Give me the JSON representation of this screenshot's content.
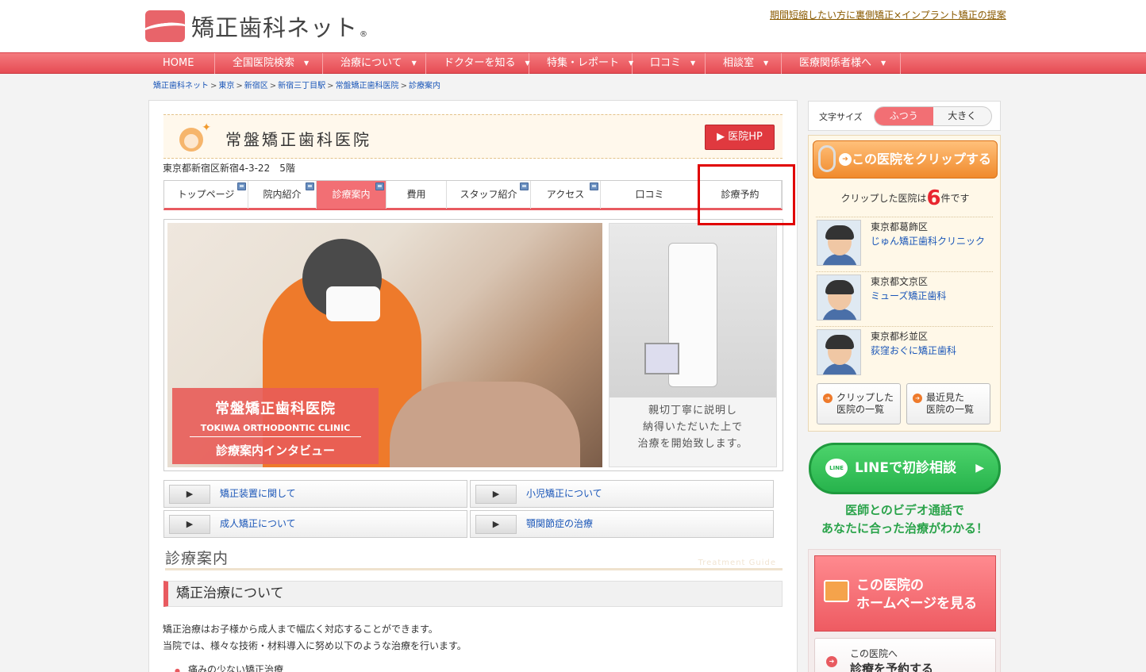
{
  "header": {
    "logo_text": "矯正歯科ネット",
    "logo_mark": "®",
    "top_link": "期間短縮したい方に裏側矯正×インプラント矯正の提案"
  },
  "nav": {
    "items": [
      {
        "label": "HOME",
        "caret": false
      },
      {
        "label": "全国医院検索",
        "caret": true
      },
      {
        "label": "治療について",
        "caret": true
      },
      {
        "label": "ドクターを知る",
        "caret": true
      },
      {
        "label": "特集・レポート",
        "caret": true
      },
      {
        "label": "口コミ",
        "caret": true
      },
      {
        "label": "相談室",
        "caret": true
      },
      {
        "label": "医療関係者様へ",
        "caret": true
      }
    ]
  },
  "breadcrumb": {
    "items": [
      "矯正歯科ネット",
      "東京",
      "新宿区",
      "新宿三丁目駅",
      "常盤矯正歯科医院",
      "診療案内"
    ],
    "sep": ">"
  },
  "clinic": {
    "name": "常盤矯正歯科医院",
    "hp_button": "▶ 医院HP",
    "address": "東京都新宿区新宿4-3-22　5階"
  },
  "tabs": [
    {
      "label": "トップページ",
      "new": true,
      "active": false
    },
    {
      "label": "院内紹介",
      "new": true,
      "active": false
    },
    {
      "label": "診療案内",
      "new": true,
      "active": true
    },
    {
      "label": "費用",
      "new": false,
      "active": false
    },
    {
      "label": "スタッフ紹介",
      "new": true,
      "active": false
    },
    {
      "label": "アクセス",
      "new": true,
      "active": false
    },
    {
      "label": "口コミ",
      "new": false,
      "active": false
    },
    {
      "label": "診療予約",
      "new": false,
      "active": false
    }
  ],
  "hero": {
    "label_title": "常盤矯正歯科医院",
    "label_en": "TOKIWA ORTHODONTIC CLINIC",
    "label_sub": "診療案内インタビュー",
    "caption_lines": [
      "親切丁寧に説明し",
      "納得いただいた上で",
      "治療を開始致します。"
    ]
  },
  "links": [
    {
      "label": "矯正装置に関して",
      "arrow": "▶"
    },
    {
      "label": "小児矯正について",
      "arrow": "▶"
    },
    {
      "label": "成人矯正について",
      "arrow": "▶"
    },
    {
      "label": "顎関節症の治療",
      "arrow": "▶"
    }
  ],
  "section": {
    "title": "診療案内",
    "title_en": "Treatment Guide",
    "subtitle": "矯正治療について",
    "paragraph_lines": [
      "矯正治療はお子様から成人まで幅広く対応することができます。",
      "当院では、様々な技術・材料導入に努め以下のような治療を行います。"
    ],
    "bullet": "痛みの少ない矯正治療"
  },
  "sidebar": {
    "font_size_label": "文字サイズ",
    "size_normal": "ふつう",
    "size_large": "大きく",
    "clip_button": "この医院をクリップする",
    "clip_count_prefix": "クリップした医院は",
    "clip_count": "6",
    "clip_count_suffix": "件です",
    "clinics": [
      {
        "area": "東京都葛飾区",
        "name": "じゅん矯正歯科クリニック"
      },
      {
        "area": "東京都文京区",
        "name": "ミューズ矯正歯科"
      },
      {
        "area": "東京都杉並区",
        "name": "荻窪おぐに矯正歯科"
      }
    ],
    "clip_list_line1": "クリップした",
    "clip_list_line2": "医院の一覧",
    "recent_line1": "最近見た",
    "recent_line2": "医院の一覧",
    "line_button": "LINEで初診相談",
    "line_icon": "LINE",
    "line_sub_line1": "医師とのビデオ通話で",
    "line_sub_line2": "あなたに合った治療がわかる！",
    "hp_line1": "この医院の",
    "hp_line2": "ホームページを見る",
    "reserve_line1": "この医院へ",
    "reserve_line2": "診療を予約する"
  },
  "colors": {
    "accent": "#e85a60",
    "nav": "#ef6268",
    "link": "#1a56b8",
    "line_green": "#27b34c",
    "highlight_box": "#e00000"
  }
}
